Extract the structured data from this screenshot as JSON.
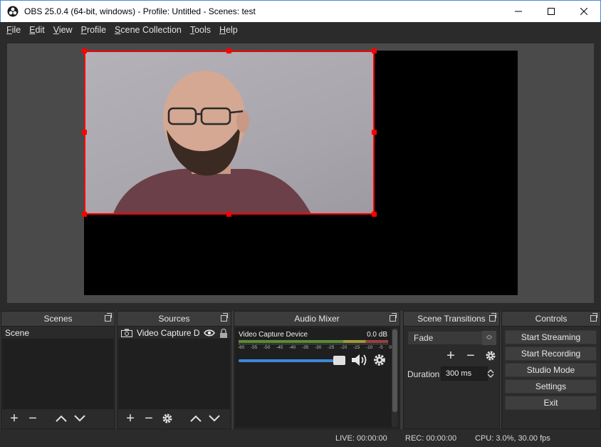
{
  "window": {
    "title": "OBS 25.0.4 (64-bit, windows) - Profile: Untitled - Scenes: test",
    "minimize_icon": "minimize-icon",
    "maximize_icon": "maximize-icon",
    "close_icon": "close-icon"
  },
  "menu": {
    "items": [
      {
        "label": "File",
        "accel": "F",
        "rest": "ile"
      },
      {
        "label": "Edit",
        "accel": "E",
        "rest": "dit"
      },
      {
        "label": "View",
        "accel": "V",
        "rest": "iew"
      },
      {
        "label": "Profile",
        "accel": "P",
        "rest": "rofile"
      },
      {
        "label": "Scene Collection",
        "accel": "S",
        "rest": "cene Collection"
      },
      {
        "label": "Tools",
        "accel": "T",
        "rest": "ools"
      },
      {
        "label": "Help",
        "accel": "H",
        "rest": "elp"
      }
    ]
  },
  "docks": {
    "scenes": {
      "title": "Scenes",
      "items": [
        "Scene"
      ]
    },
    "sources": {
      "title": "Sources",
      "items": [
        {
          "label": "Video Capture Dev",
          "icon": "camera-icon",
          "visible_icon": "eye-icon",
          "lock_icon": "lock-icon"
        }
      ]
    },
    "mixer": {
      "title": "Audio Mixer",
      "channel": "Video Capture Device",
      "level": "0.0 dB",
      "scale": [
        "-60",
        "-55",
        "-50",
        "-45",
        "-40",
        "-35",
        "-30",
        "-25",
        "-20",
        "-15",
        "-10",
        "-5",
        "0"
      ],
      "volume": 0.96
    },
    "transitions": {
      "title": "Scene Transitions",
      "selected": "Fade",
      "duration_label": "Duration",
      "duration_value": "300 ms"
    },
    "controls": {
      "title": "Controls",
      "buttons": [
        "Start Streaming",
        "Start Recording",
        "Studio Mode",
        "Settings",
        "Exit"
      ]
    }
  },
  "status": {
    "live": "LIVE: 00:00:00",
    "rec": "REC: 00:00:00",
    "cpu": "CPU: 3.0%, 30.00 fps"
  },
  "colors": {
    "selection": "#ff0000",
    "accent": "#3d88d8",
    "panel": "#2b2b2b"
  }
}
